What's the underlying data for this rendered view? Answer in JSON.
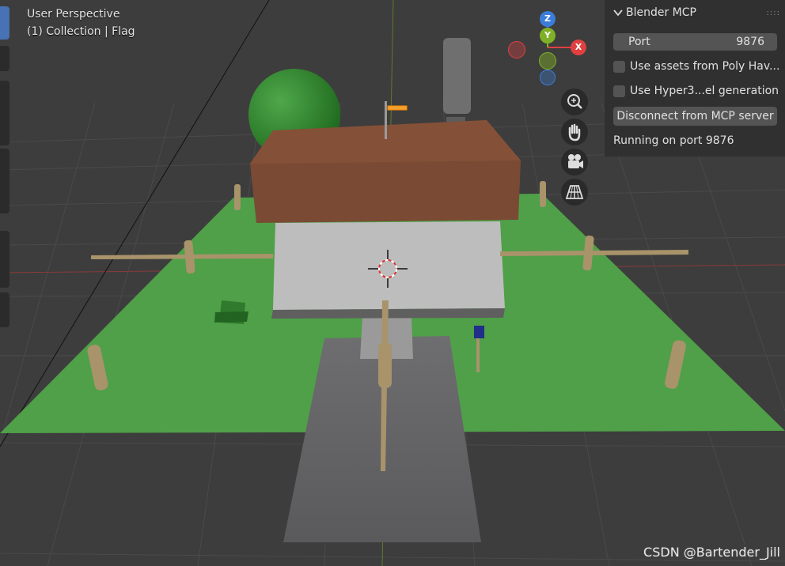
{
  "viewport": {
    "title": "User Perspective",
    "subtitle": "(1) Collection | Flag"
  },
  "gizmo": {
    "z_label": "Z",
    "y_label": "Y",
    "x_label": "X",
    "colors": {
      "x": "#e04040",
      "y": "#7fb027",
      "z": "#3b7dd8"
    }
  },
  "nav_buttons": [
    {
      "icon": "zoom-icon"
    },
    {
      "icon": "pan-hand-icon"
    },
    {
      "icon": "camera-icon"
    },
    {
      "icon": "grid-perspective-icon"
    }
  ],
  "panel": {
    "title": "Blender MCP",
    "grip": "::::",
    "port_label": "Port",
    "port_value": "9876",
    "poly_haven_label": "Use assets from Poly Hav...",
    "hyper3d_label": "Use Hyper3...el generation",
    "disconnect_label": "Disconnect from MCP server",
    "status": "Running on port 9876"
  },
  "watermark": "CSDN @Bartender_Jill"
}
